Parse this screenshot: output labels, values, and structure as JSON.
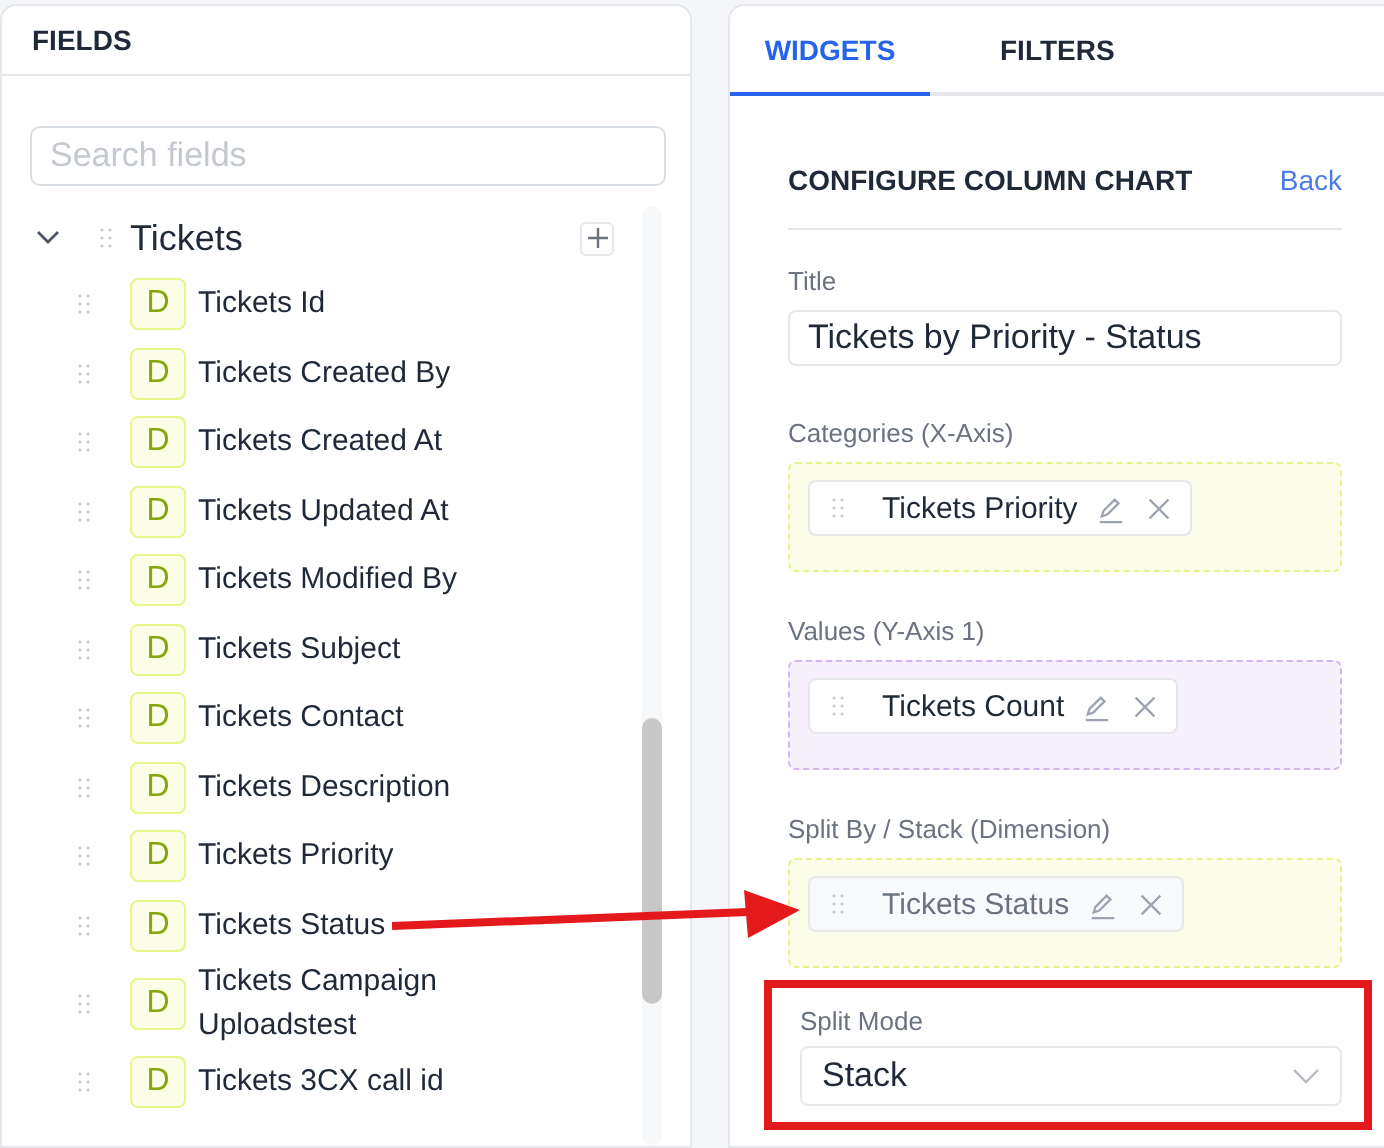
{
  "fields_panel": {
    "title": "FIELDS",
    "search": {
      "placeholder": "Search fields"
    },
    "tree": [
      {
        "label": "Tickets",
        "expanded": true,
        "children": [
          {
            "badge": "D",
            "label": "Tickets Id"
          },
          {
            "badge": "D",
            "label": "Tickets Created By"
          },
          {
            "badge": "D",
            "label": "Tickets Created At"
          },
          {
            "badge": "D",
            "label": "Tickets Updated At"
          },
          {
            "badge": "D",
            "label": "Tickets Modified By"
          },
          {
            "badge": "D",
            "label": "Tickets Subject"
          },
          {
            "badge": "D",
            "label": "Tickets Contact"
          },
          {
            "badge": "D",
            "label": "Tickets Description"
          },
          {
            "badge": "D",
            "label": "Tickets Priority"
          },
          {
            "badge": "D",
            "label": "Tickets Status"
          },
          {
            "badge": "D",
            "label": "Tickets Campaign Uploadstest"
          },
          {
            "badge": "D",
            "label": "Tickets 3CX call id"
          }
        ]
      }
    ]
  },
  "config_panel": {
    "tabs": [
      {
        "label": "WIDGETS",
        "selected": true
      },
      {
        "label": "FILTERS",
        "selected": false
      }
    ],
    "heading": "CONFIGURE COLUMN CHART",
    "back_link": "Back",
    "title_field": {
      "label": "Title",
      "value": "Tickets by Priority - Status"
    },
    "zones": [
      {
        "label": "Categories (X-Axis)",
        "kind": "dimension",
        "chips": [
          {
            "label": "Tickets Priority",
            "dimmed": false
          }
        ]
      },
      {
        "label": "Values (Y-Axis 1)",
        "kind": "measure",
        "chips": [
          {
            "label": "Tickets Count",
            "dimmed": false
          }
        ]
      },
      {
        "label": "Split By / Stack (Dimension)",
        "kind": "dimension",
        "chips": [
          {
            "label": "Tickets Status",
            "dimmed": true
          }
        ]
      }
    ],
    "split_mode": {
      "label": "Split Mode",
      "value": "Stack"
    }
  }
}
